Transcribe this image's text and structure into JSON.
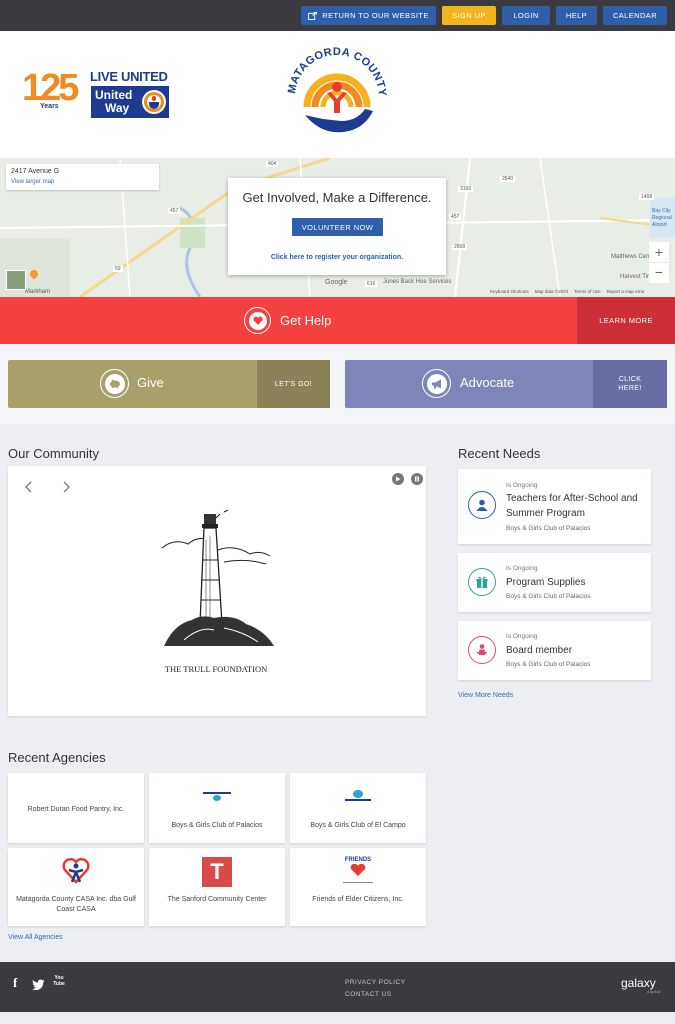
{
  "topbar": {
    "return_label": "RETURN TO OUR WEBSITE",
    "signup_label": "SIGN UP",
    "login_label": "LOGIN",
    "help_label": "HELP",
    "calendar_label": "CALENDAR"
  },
  "header": {
    "years_number": "125",
    "years_label": "Years",
    "live_united": "LIVE UNITED",
    "united_way_line1": "United",
    "united_way_line2": "Way",
    "county_logo_text": "MATAGORDA COUNTY"
  },
  "map": {
    "address": "2417 Avenue G",
    "view_larger": "View larger map",
    "cta_title": "Get Involved, Make a Difference.",
    "volunteer_label": "VOLUNTEER NOW",
    "register_link": "Click here to register your organization.",
    "place_labels": [
      "Markham",
      "Google",
      "Jones Back Hoe Services",
      "Matthews Cemetery",
      "Harvest Time",
      "Bay City Regional Airport"
    ],
    "road_numbers": [
      "404",
      "457",
      "457",
      "616",
      "1468",
      "3156",
      "2540",
      "2668",
      "59"
    ],
    "footer_items": [
      "Keyboard shortcuts",
      "Map data ©2023",
      "Terms of Use",
      "Report a map error"
    ]
  },
  "get_help": {
    "label": "Get Help",
    "learn_more": "LEARN MORE"
  },
  "give": {
    "label": "Give",
    "action": "LET'S GO!",
    "color": "#a8a06a",
    "action_color": "#8a8256"
  },
  "advocate": {
    "label": "Advocate",
    "action_line1": "CLICK",
    "action_line2": "HERE!",
    "color": "#7f84bb",
    "action_color": "#686ea3"
  },
  "community": {
    "title": "Our Community",
    "featured_caption": "THE TRULL FOUNDATION"
  },
  "needs": {
    "title": "Recent Needs",
    "items": [
      {
        "tag": "Is Ongoing",
        "title": "Teachers for After-School and Summer Program",
        "org": "Boys & Girls Club of Palacios",
        "icon": "person-icon",
        "color": "#2f5faa"
      },
      {
        "tag": "Is Ongoing",
        "title": "Program Supplies",
        "org": "Boys & Girls Club of Palacios",
        "icon": "gift-icon",
        "color": "#2aa39a"
      },
      {
        "tag": "Is Ongoing",
        "title": "Board member",
        "org": "Boys & Girls Club of Palacios",
        "icon": "board-icon",
        "color": "#e0457b"
      }
    ],
    "view_more": "View More Needs"
  },
  "agencies": {
    "title": "Recent Agencies",
    "items": [
      {
        "name": "Robert Duran Food Pantry, Inc."
      },
      {
        "name": "Boys & Girls Club of Palacios"
      },
      {
        "name": "Boys & Girls Club of El Campo"
      },
      {
        "name": "Matagorda County CASA Inc. dba Gulf Coast CASA"
      },
      {
        "name": "The Sanford Community Center"
      },
      {
        "name": "Friends of Elder Citizens, Inc."
      }
    ],
    "sanford_logo_letter": "T",
    "friends_logo_text": "FRIENDS",
    "view_all": "View All Agencies"
  },
  "footer": {
    "privacy": "PRIVACY POLICY",
    "contact": "CONTACT US",
    "brand": "galaxy",
    "brand_sub": "digital",
    "social_facebook": "f",
    "social_youtube": "You Tube"
  }
}
